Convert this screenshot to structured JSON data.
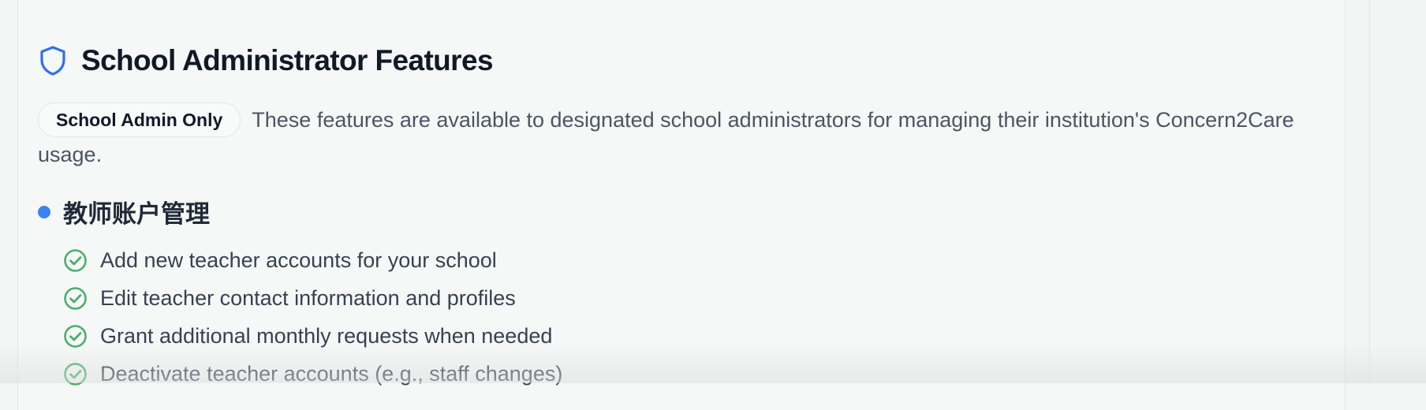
{
  "section": {
    "title": "School Administrator Features",
    "badge": "School Admin Only",
    "description": "These features are available to designated school administrators for managing their institution's Concern2Care usage.",
    "subsection_title": "教师账户管理",
    "features": [
      "Add new teacher accounts for your school",
      "Edit teacher contact information and profiles",
      "Grant additional monthly requests when needed",
      "Deactivate teacher accounts (e.g., staff changes)"
    ]
  },
  "icons": {
    "header": "shield-icon",
    "feature": "check-circle-icon",
    "bullet": "dot-icon"
  },
  "colors": {
    "accent": "#3b82f6",
    "check": "#4caf6b",
    "title": "#111827",
    "body_text": "#4b5563"
  }
}
